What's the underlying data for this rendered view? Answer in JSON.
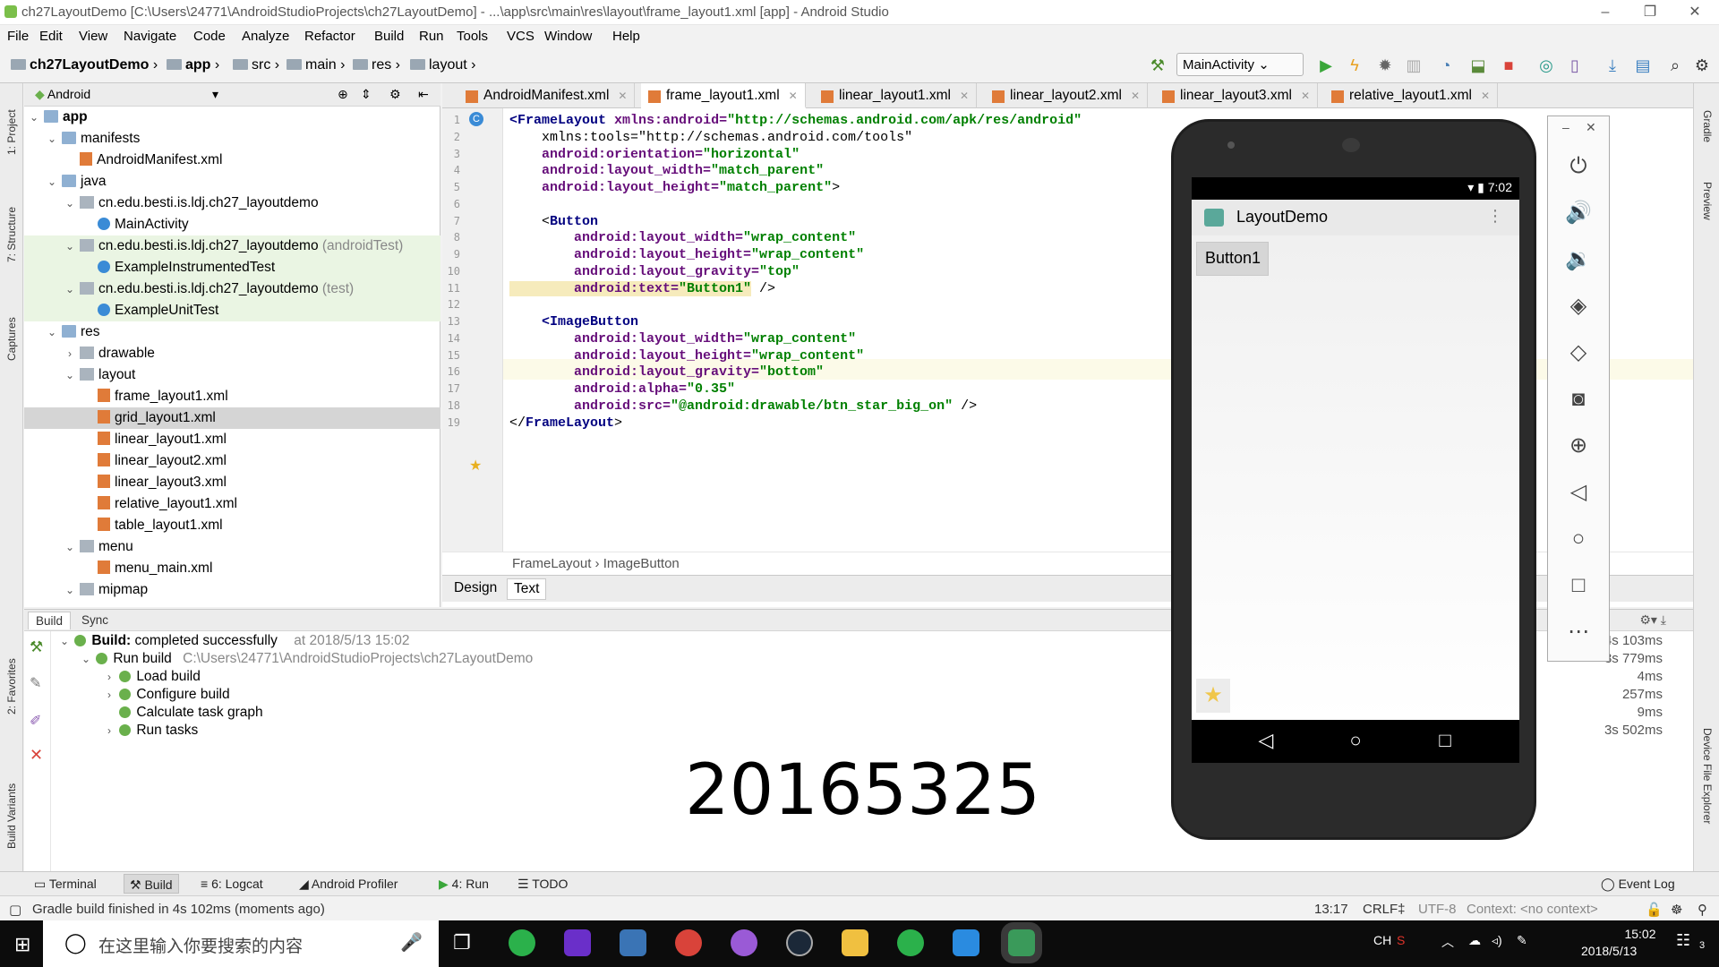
{
  "window": {
    "title": "ch27LayoutDemo [C:\\Users\\24771\\AndroidStudioProjects\\ch27LayoutDemo] - ...\\app\\src\\main\\res\\layout\\frame_layout1.xml [app] - Android Studio",
    "minimize": "–",
    "maximize": "❐",
    "close": "✕"
  },
  "menu": [
    "File",
    "Edit",
    "View",
    "Navigate",
    "Code",
    "Analyze",
    "Refactor",
    "Build",
    "Run",
    "Tools",
    "VCS",
    "Window",
    "Help"
  ],
  "nav": {
    "crumbs": [
      "ch27LayoutDemo",
      "app",
      "src",
      "main",
      "res",
      "layout"
    ],
    "run_config": "MainActivity"
  },
  "project": {
    "view": "Android",
    "tree": [
      {
        "label": "app",
        "indent": 0,
        "arrow": "⌄",
        "icon": "fold",
        "bold": true
      },
      {
        "label": "manifests",
        "indent": 1,
        "arrow": "⌄",
        "icon": "fold"
      },
      {
        "label": "AndroidManifest.xml",
        "indent": 2,
        "arrow": "",
        "icon": "xml"
      },
      {
        "label": "java",
        "indent": 1,
        "arrow": "⌄",
        "icon": "fold"
      },
      {
        "label": "cn.edu.besti.is.ldj.ch27_layoutdemo",
        "indent": 2,
        "arrow": "⌄",
        "icon": "folderg"
      },
      {
        "label": "MainActivity",
        "indent": 3,
        "arrow": "",
        "icon": "cls"
      },
      {
        "label": "cn.edu.besti.is.ldj.ch27_layoutdemo",
        "suffix": " (androidTest)",
        "indent": 2,
        "arrow": "⌄",
        "icon": "folderg",
        "green": true
      },
      {
        "label": "ExampleInstrumentedTest",
        "indent": 3,
        "arrow": "",
        "icon": "cls",
        "green": true
      },
      {
        "label": "cn.edu.besti.is.ldj.ch27_layoutdemo",
        "suffix": " (test)",
        "indent": 2,
        "arrow": "⌄",
        "icon": "folderg",
        "green": true
      },
      {
        "label": "ExampleUnitTest",
        "indent": 3,
        "arrow": "",
        "icon": "cls",
        "green": true
      },
      {
        "label": "res",
        "indent": 1,
        "arrow": "⌄",
        "icon": "fold"
      },
      {
        "label": "drawable",
        "indent": 2,
        "arrow": "›",
        "icon": "folderg"
      },
      {
        "label": "layout",
        "indent": 2,
        "arrow": "⌄",
        "icon": "folderg"
      },
      {
        "label": "frame_layout1.xml",
        "indent": 3,
        "arrow": "",
        "icon": "xml"
      },
      {
        "label": "grid_layout1.xml",
        "indent": 3,
        "arrow": "",
        "icon": "xml",
        "selected": true
      },
      {
        "label": "linear_layout1.xml",
        "indent": 3,
        "arrow": "",
        "icon": "xml"
      },
      {
        "label": "linear_layout2.xml",
        "indent": 3,
        "arrow": "",
        "icon": "xml"
      },
      {
        "label": "linear_layout3.xml",
        "indent": 3,
        "arrow": "",
        "icon": "xml"
      },
      {
        "label": "relative_layout1.xml",
        "indent": 3,
        "arrow": "",
        "icon": "xml"
      },
      {
        "label": "table_layout1.xml",
        "indent": 3,
        "arrow": "",
        "icon": "xml"
      },
      {
        "label": "menu",
        "indent": 2,
        "arrow": "⌄",
        "icon": "folderg"
      },
      {
        "label": "menu_main.xml",
        "indent": 3,
        "arrow": "",
        "icon": "xml"
      },
      {
        "label": "mipmap",
        "indent": 2,
        "arrow": "⌄",
        "icon": "folderg"
      }
    ]
  },
  "tabs": [
    "AndroidManifest.xml",
    "frame_layout1.xml",
    "linear_layout1.xml",
    "linear_layout2.xml",
    "linear_layout3.xml",
    "relative_layout1.xml"
  ],
  "active_tab": "frame_layout1.xml",
  "code": [
    [
      [
        "<",
        "tag"
      ],
      [
        "FrameLayout ",
        "tag"
      ],
      [
        "xmlns:android=",
        "attr"
      ],
      [
        "\"http://schemas.android.com/apk/res/android\"",
        "val"
      ]
    ],
    [
      [
        "    xmlns:tools=\"http://schemas.android.com/tools\"",
        "plain"
      ]
    ],
    [
      [
        "    android:orientation=",
        "attr"
      ],
      [
        "\"horizontal\"",
        "val"
      ]
    ],
    [
      [
        "    android:layout_width=",
        "attr"
      ],
      [
        "\"match_parent\"",
        "val"
      ]
    ],
    [
      [
        "    android:layout_height=",
        "attr"
      ],
      [
        "\"match_parent\"",
        "val"
      ],
      [
        ">",
        "plain"
      ]
    ],
    [
      [
        "",
        "plain"
      ]
    ],
    [
      [
        "    <",
        "plain"
      ],
      [
        "Button",
        "tag"
      ]
    ],
    [
      [
        "        android:layout_width=",
        "attr"
      ],
      [
        "\"wrap_content\"",
        "val"
      ]
    ],
    [
      [
        "        android:layout_height=",
        "attr"
      ],
      [
        "\"wrap_content\"",
        "val"
      ]
    ],
    [
      [
        "        android:layout_gravity=",
        "attr"
      ],
      [
        "\"top\"",
        "val"
      ]
    ],
    [
      [
        "        android:text=",
        "attr"
      ],
      [
        "\"Button1\"",
        "val"
      ],
      [
        " />",
        "plain"
      ]
    ],
    [
      [
        "",
        "plain"
      ]
    ],
    [
      [
        "    <",
        "tag"
      ],
      [
        "ImageButton",
        "tag"
      ]
    ],
    [
      [
        "        android:layout_width=",
        "attr"
      ],
      [
        "\"wrap_content\"",
        "val"
      ]
    ],
    [
      [
        "        android:layout_height=",
        "attr"
      ],
      [
        "\"wrap_content\"",
        "val"
      ]
    ],
    [
      [
        "        android:layout_gravity=",
        "attr"
      ],
      [
        "\"bottom\"",
        "val"
      ]
    ],
    [
      [
        "        android:alpha=",
        "attr"
      ],
      [
        "\"0.35\"",
        "val"
      ]
    ],
    [
      [
        "        android:src=",
        "attr"
      ],
      [
        "\"@android:drawable/btn_star_big_on\"",
        "val"
      ],
      [
        " />",
        "plain"
      ]
    ],
    [
      [
        "</",
        "plain"
      ],
      [
        "FrameLayout",
        "tag"
      ],
      [
        ">",
        "plain"
      ]
    ]
  ],
  "line_numbers": [
    "1",
    "2",
    "3",
    "4",
    "5",
    "6",
    "7",
    "8",
    "9",
    "10",
    "11",
    "12",
    "13",
    "14",
    "15",
    "16",
    "17",
    "18",
    "19"
  ],
  "editor_breadcrumb": {
    "a": "FrameLayout",
    "sep": "›",
    "b": "ImageButton"
  },
  "design_tabs": {
    "design": "Design",
    "text": "Text"
  },
  "build": {
    "tab_build": "Build",
    "tab_sync": "Sync",
    "status_label": "Build:",
    "status": "completed successfully",
    "at": "at 2018/5/13 15:02",
    "run_build": "Run build",
    "run_path": "C:\\Users\\24771\\AndroidStudioProjects\\ch27LayoutDemo",
    "steps": [
      "Load build",
      "Configure build",
      "Calculate task graph",
      "Run tasks"
    ],
    "times": [
      "4s 103ms",
      "3s 779ms",
      "4ms",
      "257ms",
      "9ms",
      "3s 502ms"
    ],
    "overlay": "20165325"
  },
  "side": {
    "left": [
      "1: Project",
      "7: Structure",
      "Captures",
      "2: Favorites",
      "Build Variants"
    ],
    "right": [
      "Gradle",
      "Preview",
      "Device File Explorer"
    ]
  },
  "bottom_tabs": [
    "Terminal",
    "Build",
    "6: Logcat",
    "Android Profiler",
    "4: Run",
    "TODO",
    "Event Log"
  ],
  "status": {
    "message": "Gradle build finished in 4s 102ms (moments ago)",
    "position": "13:17",
    "line_sep": "CRLF‡",
    "encoding": "UTF-8",
    "context": "Context: <no context>"
  },
  "emulator": {
    "clock": "7:02",
    "app_title": "LayoutDemo",
    "button": "Button1",
    "minimize": "–",
    "close": "✕"
  },
  "taskbar": {
    "search_placeholder": "在这里输入你要搜索的内容",
    "ime": "CH",
    "time": "15:02",
    "date": "2018/5/13",
    "notif": "3"
  }
}
